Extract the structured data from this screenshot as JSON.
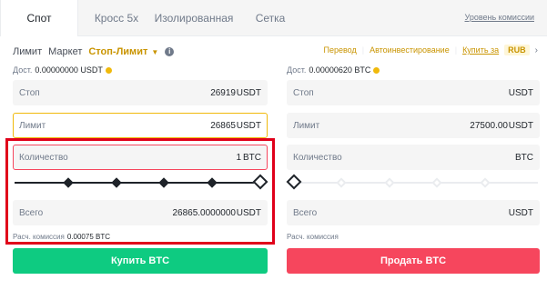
{
  "tabs": [
    {
      "label": "Спот"
    },
    {
      "label": "Кросс 5x"
    },
    {
      "label": "Изолированная"
    },
    {
      "label": "Сетка"
    }
  ],
  "fee_link": "Уровень комиссии",
  "order_types": {
    "limit": "Лимит",
    "market": "Маркет",
    "stop_limit": "Стоп-Лимит"
  },
  "links": {
    "transfer": "Перевод",
    "auto_invest": "Автоинвестирование",
    "buy_with": "Купить за",
    "currency": "RUB"
  },
  "buy": {
    "avail_label": "Дост.",
    "avail_value": "0.00000000 USDT",
    "stop_label": "Стоп",
    "stop_value": "26919",
    "stop_unit": "USDT",
    "limit_label": "Лимит",
    "limit_value": "26865",
    "limit_unit": "USDT",
    "qty_label": "Количество",
    "qty_value": "1",
    "qty_unit": "BTC",
    "slider_percent": 100,
    "total_label": "Всего",
    "total_value": "26865.0000000",
    "total_unit": "USDT",
    "fee_label": "Расч. комиссия",
    "fee_value": "0.00075 BTC",
    "button": "Купить BTC"
  },
  "sell": {
    "avail_label": "Дост.",
    "avail_value": "0.00000620 BTC",
    "stop_label": "Стоп",
    "stop_unit": "USDT",
    "limit_label": "Лимит",
    "limit_value": "27500.00",
    "limit_unit": "USDT",
    "qty_label": "Количество",
    "qty_unit": "BTC",
    "slider_percent": 0,
    "total_label": "Всего",
    "total_unit": "USDT",
    "fee_label": "Расч. комиссия",
    "button": "Продать BTC"
  },
  "colors": {
    "accent": "#c99400",
    "buy": "#0ecb81",
    "sell": "#f6465d",
    "highlight_box": "#e0001a"
  }
}
